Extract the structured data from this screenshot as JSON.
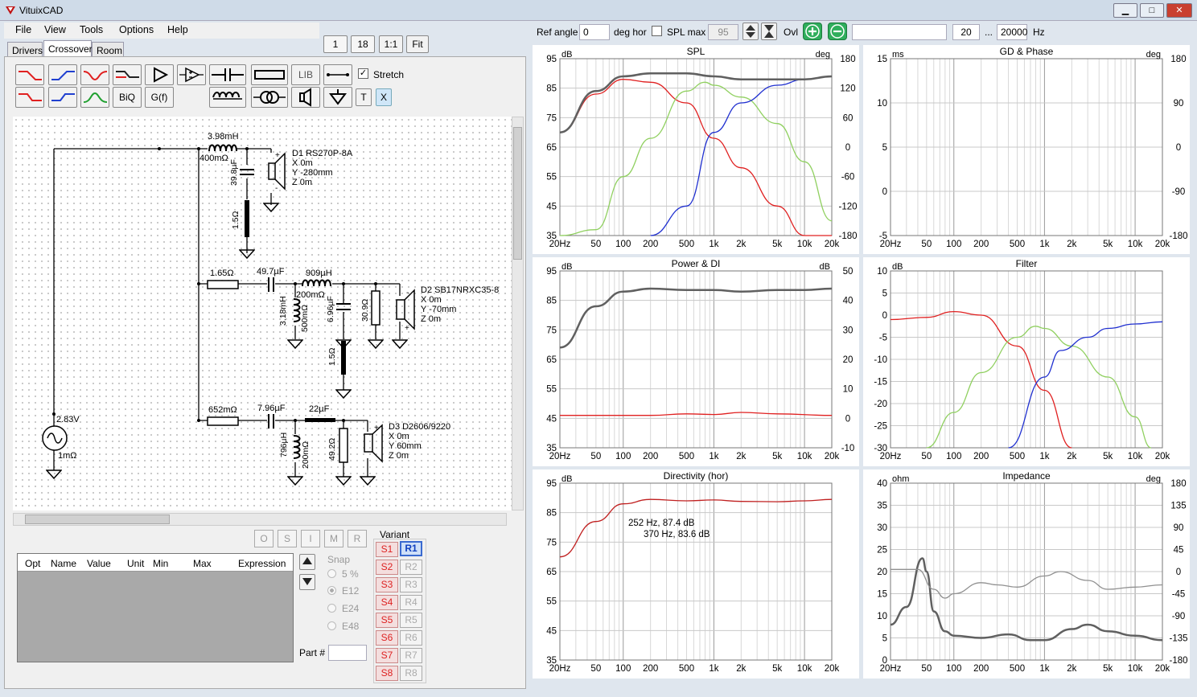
{
  "app": {
    "title": "VituixCAD"
  },
  "window": {
    "min": "▁",
    "max": "□",
    "close": "✕"
  },
  "menu": {
    "file": "File",
    "view": "View",
    "tools": "Tools",
    "options": "Options",
    "help": "Help"
  },
  "zoom": {
    "one": "1",
    "eighteen": "18",
    "oneone": "1:1",
    "fit": "Fit"
  },
  "tabs": {
    "drivers": "Drivers",
    "crossover": "Crossover",
    "room": "Room"
  },
  "toolbar": {
    "lib": "LIB",
    "biq": "BiQ",
    "gf": "G(f)",
    "t": "T",
    "x": "X",
    "stretch": "Stretch",
    "stretch_checked": true
  },
  "schematic": {
    "l1": "3.98mH",
    "l1r": "400mΩ",
    "c1": "39.8µF",
    "r1": "1.5Ω",
    "d1": [
      "D1 RS270P-8A",
      "X 0m",
      "Y -280mm",
      "Z 0m"
    ],
    "r2": "1.65Ω",
    "c2": "49.7µF",
    "l2": "909µH",
    "l2r": "200mΩ",
    "l3": "3.18mH",
    "l3r": "500mΩ",
    "c3": "6.96µF",
    "r3": "30.9Ω",
    "r4": "1.5Ω",
    "d2": [
      "D2 SB17NRXC35-8",
      "X 0m",
      "Y -70mm",
      "Z 0m"
    ],
    "r5": "652mΩ",
    "c4": "7.96µF",
    "c5": "22µF",
    "l4": "796µH",
    "l4r": "200mΩ",
    "r6": "49.2Ω",
    "d3": [
      "D3 D2606/9220",
      "X 0m",
      "Y 60mm",
      "Z 0m"
    ],
    "src_v": "2.83V",
    "src_r": "1mΩ"
  },
  "optbuttons": [
    "O",
    "S",
    "I",
    "M",
    "R"
  ],
  "table": {
    "headers": [
      "Opt",
      "Name",
      "Value",
      "Unit",
      "Min",
      "Max",
      "Expression"
    ]
  },
  "snap": {
    "label": "Snap",
    "options": [
      "5 %",
      "E12",
      "E24",
      "E48"
    ],
    "selected": "E12"
  },
  "part": {
    "label": "Part #"
  },
  "variant": {
    "label": "Variant",
    "s": [
      "S1",
      "S2",
      "S3",
      "S4",
      "S5",
      "S6",
      "S7",
      "S8"
    ],
    "r": [
      "R1",
      "R2",
      "R3",
      "R4",
      "R5",
      "R6",
      "R7",
      "R8"
    ],
    "selected": "R1"
  },
  "top": {
    "ref_angle_label": "Ref angle",
    "ref_angle": "0",
    "deg_hor": "deg hor",
    "spl_max_label": "SPL max",
    "spl_max": "95",
    "ovl": "Ovl",
    "f_from": "20",
    "dots": "...",
    "f_to": "20000",
    "hz": "Hz"
  },
  "xticks": [
    "20Hz",
    "50",
    "100",
    "200",
    "500",
    "1k",
    "2k",
    "5k",
    "10k",
    "20k"
  ],
  "charts": {
    "spl": {
      "title": "SPL",
      "yl": "dB",
      "yr": "deg",
      "left": [
        "95",
        "85",
        "75",
        "65",
        "55",
        "45",
        "35"
      ],
      "right": [
        "180",
        "120",
        "60",
        "0",
        "-60",
        "-120",
        "-180"
      ]
    },
    "gd": {
      "title": "GD & Phase",
      "yl": "ms",
      "yr": "deg",
      "left": [
        "15",
        "10",
        "5",
        "0",
        "-5"
      ],
      "right": [
        "180",
        "90",
        "0",
        "-90",
        "-180"
      ]
    },
    "power": {
      "title": "Power & DI",
      "yl": "dB",
      "yr": "dB",
      "left": [
        "95",
        "85",
        "75",
        "65",
        "55",
        "45",
        "35"
      ],
      "right": [
        "50",
        "40",
        "30",
        "20",
        "10",
        "0",
        "-10"
      ]
    },
    "filter": {
      "title": "Filter",
      "yl": "dB",
      "left": [
        "10",
        "5",
        "0",
        "-5",
        "-10",
        "-15",
        "-20",
        "-25",
        "-30"
      ]
    },
    "dir": {
      "title": "Directivity (hor)",
      "yl": "dB",
      "left": [
        "95",
        "85",
        "75",
        "65",
        "55",
        "45",
        "35"
      ],
      "ann1": "252 Hz, 87.4 dB",
      "ann2": "370 Hz, 83.6 dB"
    },
    "imp": {
      "title": "Impedance",
      "yl": "ohm",
      "yr": "deg",
      "left": [
        "40",
        "35",
        "30",
        "25",
        "20",
        "15",
        "10",
        "5",
        "0"
      ],
      "right": [
        "180",
        "135",
        "90",
        "45",
        "0",
        "-45",
        "-90",
        "-135",
        "-180"
      ]
    }
  },
  "chart_data": [
    {
      "type": "line",
      "title": "SPL",
      "ylim": [
        35,
        95
      ],
      "y2lim": [
        -180,
        180
      ],
      "series": [
        {
          "color": "#e02020",
          "x": [
            20,
            50,
            100,
            200,
            500,
            1000,
            2000,
            5000,
            10000,
            20000
          ],
          "y": [
            70,
            83,
            88,
            87,
            80,
            68,
            58,
            45,
            33,
            22
          ]
        },
        {
          "color": "#90d060",
          "x": [
            20,
            50,
            100,
            200,
            500,
            800,
            1000,
            2000,
            5000,
            10000,
            20000
          ],
          "y": [
            20,
            37,
            55,
            68,
            84,
            87,
            86,
            82,
            73,
            60,
            40
          ]
        },
        {
          "color": "#2030d0",
          "x": [
            200,
            500,
            1000,
            2000,
            5000,
            10000,
            20000
          ],
          "y": [
            30,
            45,
            70,
            80,
            86,
            88,
            89
          ]
        },
        {
          "color": "#606060",
          "x": [
            20,
            50,
            100,
            200,
            500,
            1000,
            2000,
            5000,
            10000,
            20000
          ],
          "y": [
            70,
            84,
            89,
            90,
            90,
            89,
            88,
            88,
            88,
            89
          ]
        }
      ]
    },
    {
      "type": "line",
      "title": "Power & DI",
      "ylim": [
        35,
        95
      ],
      "series": [
        {
          "color": "#606060",
          "x": [
            20,
            50,
            100,
            200,
            500,
            1000,
            2000,
            5000,
            10000,
            20000
          ],
          "y": [
            69,
            83,
            88,
            89,
            88.5,
            88.5,
            88,
            88.5,
            88.5,
            89
          ]
        },
        {
          "color": "#e02020",
          "x": [
            20,
            200,
            500,
            1000,
            2000,
            5000,
            20000
          ],
          "y": [
            1,
            1,
            1.5,
            1.3,
            2,
            1.5,
            1
          ]
        }
      ]
    },
    {
      "type": "line",
      "title": "Filter",
      "ylim": [
        -30,
        10
      ],
      "series": [
        {
          "color": "#e02020",
          "x": [
            20,
            50,
            100,
            200,
            500,
            1000,
            2000
          ],
          "y": [
            -1,
            -0.5,
            0.8,
            0,
            -7,
            -17,
            -30
          ]
        },
        {
          "color": "#90d060",
          "x": [
            50,
            100,
            200,
            500,
            800,
            1000,
            2000,
            5000,
            10000,
            15000
          ],
          "y": [
            -30,
            -22,
            -13,
            -5,
            -2.5,
            -3,
            -7,
            -14,
            -23,
            -30
          ]
        },
        {
          "color": "#2030d0",
          "x": [
            400,
            1000,
            1500,
            3000,
            5000,
            10000,
            20000
          ],
          "y": [
            -30,
            -14,
            -8,
            -5,
            -3,
            -2,
            -1.5
          ]
        }
      ]
    },
    {
      "type": "line",
      "title": "Directivity (hor)",
      "ylim": [
        35,
        95
      ],
      "series": [
        {
          "color": "#c02020",
          "x": [
            20,
            50,
            100,
            200,
            500,
            1000,
            2000,
            5000,
            10000,
            20000
          ],
          "y": [
            70,
            82,
            88,
            89.5,
            89,
            89.3,
            88.8,
            88.7,
            89,
            89.5
          ]
        }
      ]
    },
    {
      "type": "line",
      "title": "Impedance",
      "ylim": [
        0,
        40
      ],
      "series": [
        {
          "color": "#606060",
          "x": [
            20,
            30,
            45,
            50,
            60,
            80,
            100,
            200,
            400,
            700,
            1000,
            2000,
            3000,
            5000,
            10000,
            20000
          ],
          "y": [
            8,
            12,
            23,
            20,
            11,
            6.5,
            5.5,
            5,
            5.8,
            4.5,
            4.5,
            7,
            8,
            6.5,
            5.5,
            4.5
          ]
        },
        {
          "color": "#909090",
          "x": [
            20,
            40,
            60,
            80,
            100,
            200,
            300,
            500,
            1000,
            1500,
            3000,
            5000,
            10000,
            20000
          ],
          "y": [
            20.5,
            20.5,
            16,
            14,
            15,
            17.5,
            17,
            16.5,
            19,
            20,
            18,
            16,
            16.5,
            17
          ]
        }
      ]
    }
  ]
}
